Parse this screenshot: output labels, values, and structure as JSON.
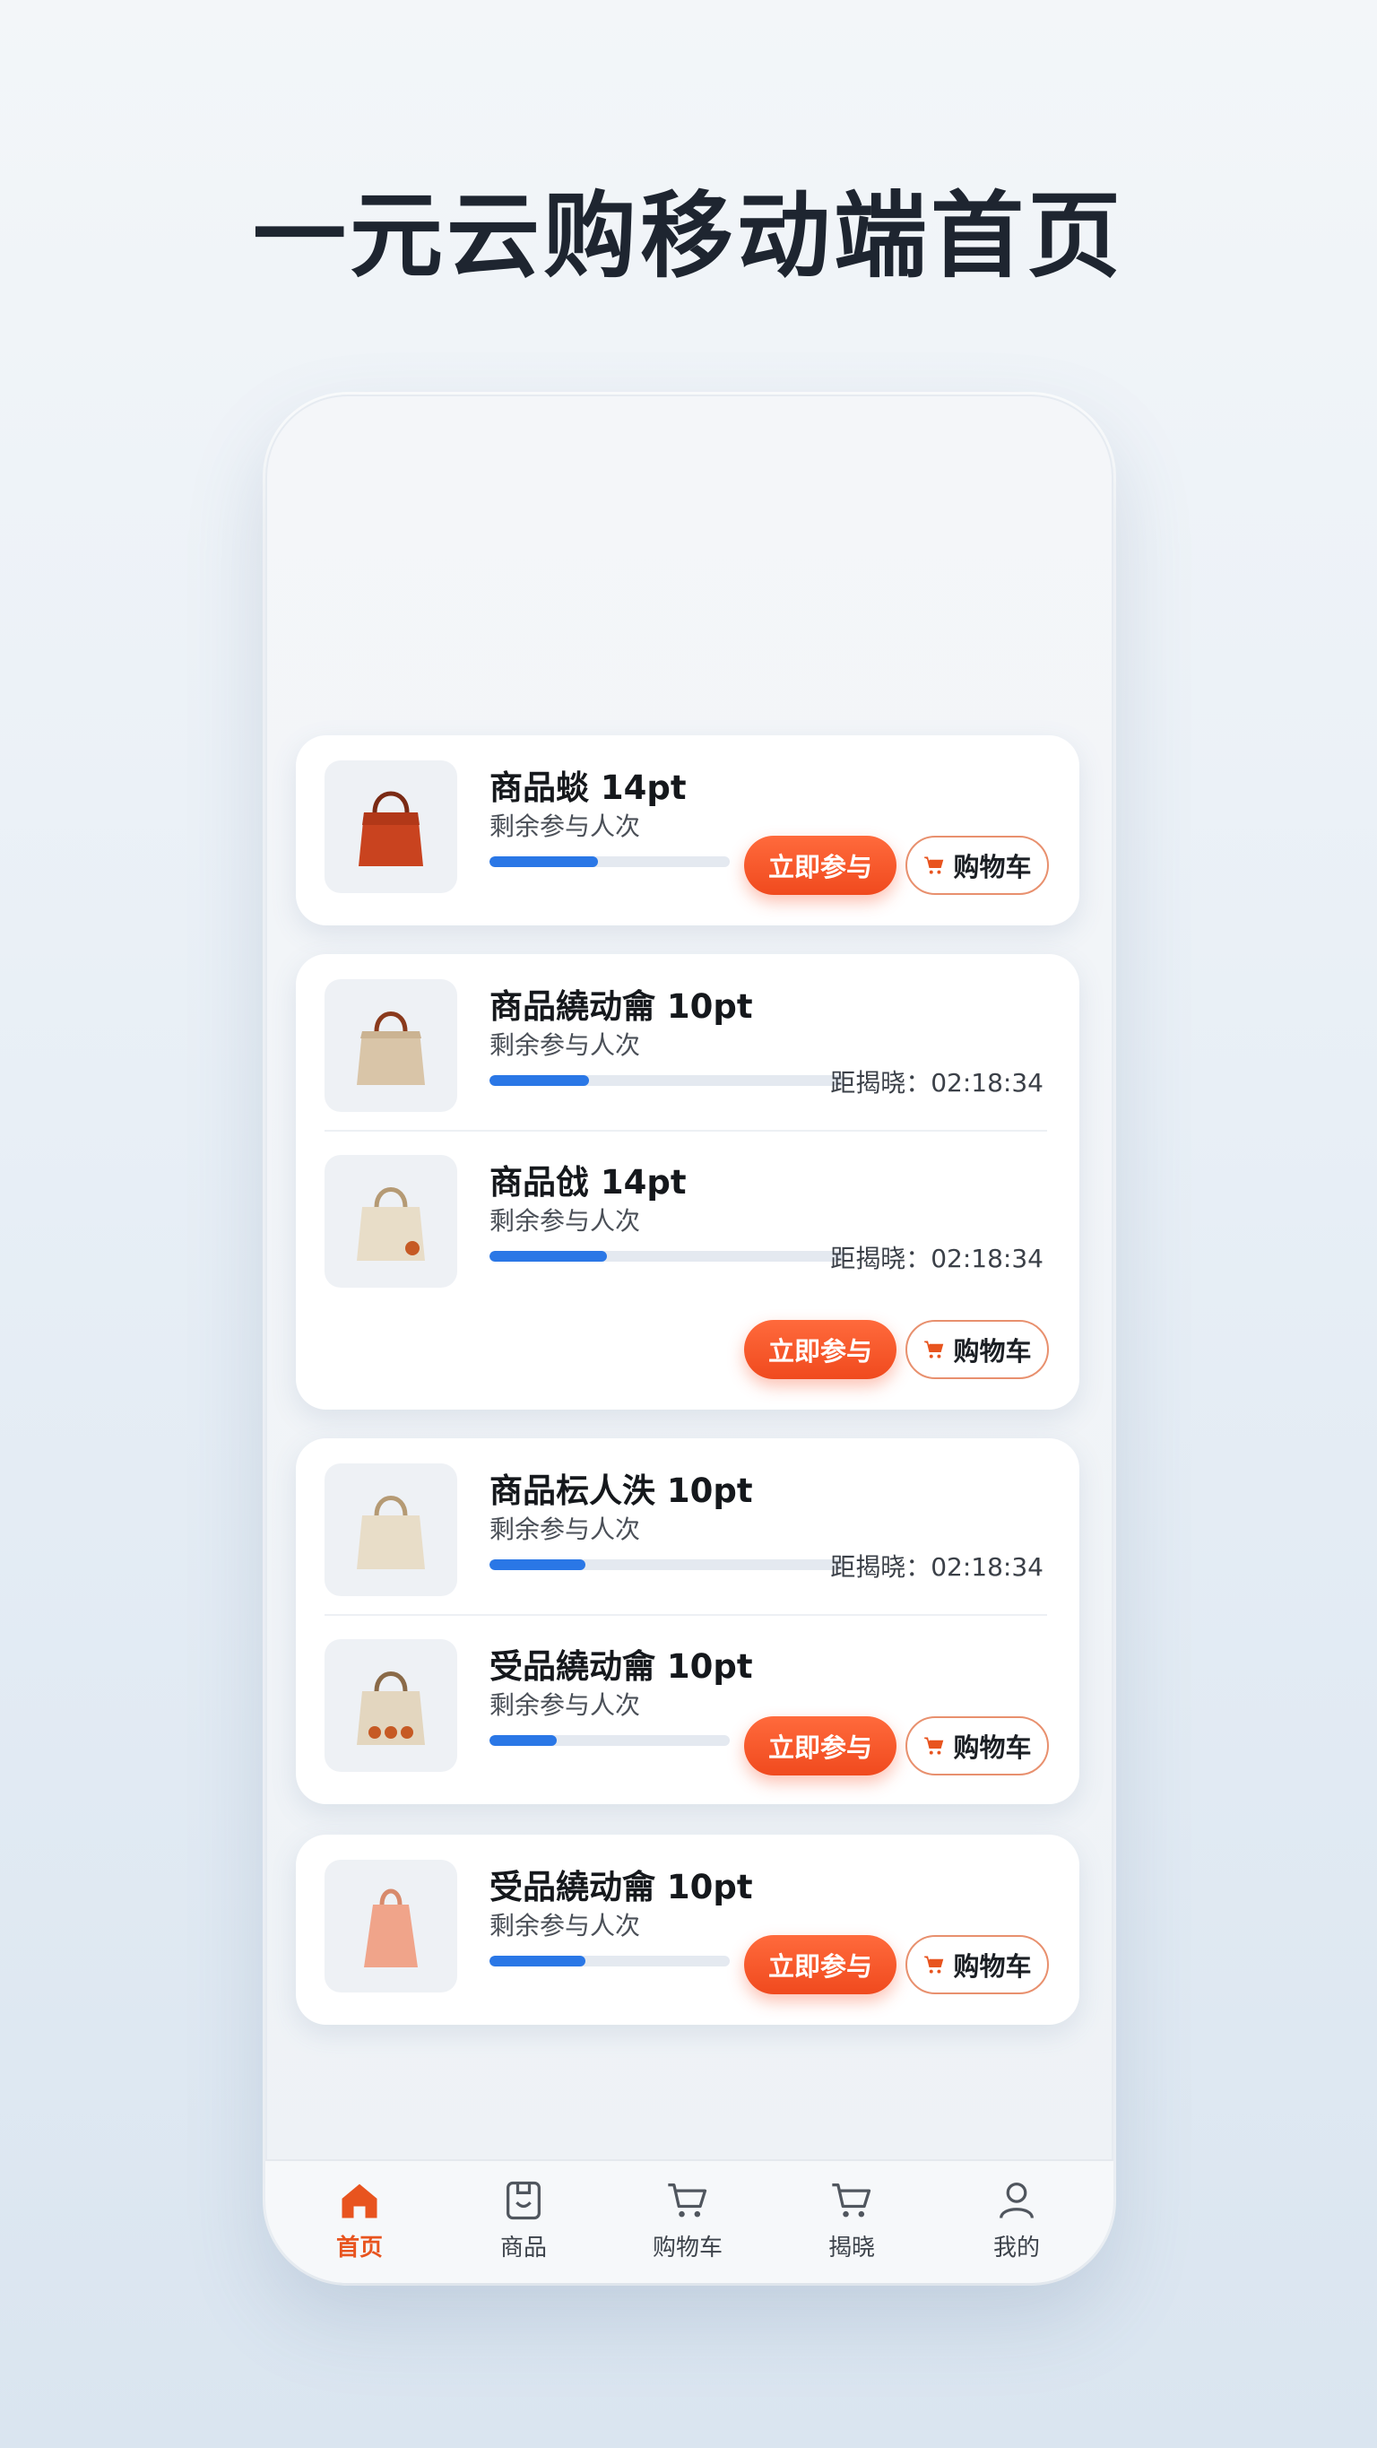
{
  "page_title": "一元云购移动端首页",
  "accent_color": "#f04a1e",
  "progress_color": "#2a77e6",
  "join_label": "立即参与",
  "cart_label": "购物车",
  "items": [
    {
      "title": "商品䗊 14pt",
      "subtitle": "剩余参与人次",
      "progress": 0.45,
      "countdown": null,
      "icon": "tote-bag-red"
    },
    {
      "title": "商品繞动龠 10pt",
      "subtitle": "剩余参与人次",
      "progress": 0.28,
      "countdown": "距揭晓：02:18:34",
      "icon": "tote-bag-beige"
    },
    {
      "title": "商品戗 14pt",
      "subtitle": "剩余参与人次",
      "progress": 0.33,
      "countdown": "距揭晓：02:18:34",
      "icon": "tote-bag-cream"
    },
    {
      "title": "商品枟人泆 10pt",
      "subtitle": "剩余参与人次",
      "progress": 0.27,
      "countdown": "距揭晓：02:18:34",
      "icon": "tote-bag-cream"
    },
    {
      "title": "受品繞动龠 10pt",
      "subtitle": "剩余参与人次",
      "progress": 0.28,
      "countdown": null,
      "icon": "tote-bag-beige"
    },
    {
      "title": "受品繞动龠 10pt",
      "subtitle": "剩余参与人次",
      "progress": 0.4,
      "countdown": null,
      "icon": "bag-peach"
    }
  ],
  "tabbar": [
    {
      "label": "首页",
      "icon": "home-icon",
      "active": true
    },
    {
      "label": "商品",
      "icon": "product-icon",
      "active": false
    },
    {
      "label": "购物车",
      "icon": "cart-icon",
      "active": false
    },
    {
      "label": "揭晓",
      "icon": "cart-icon",
      "active": false
    },
    {
      "label": "我的",
      "icon": "user-icon",
      "active": false
    }
  ]
}
